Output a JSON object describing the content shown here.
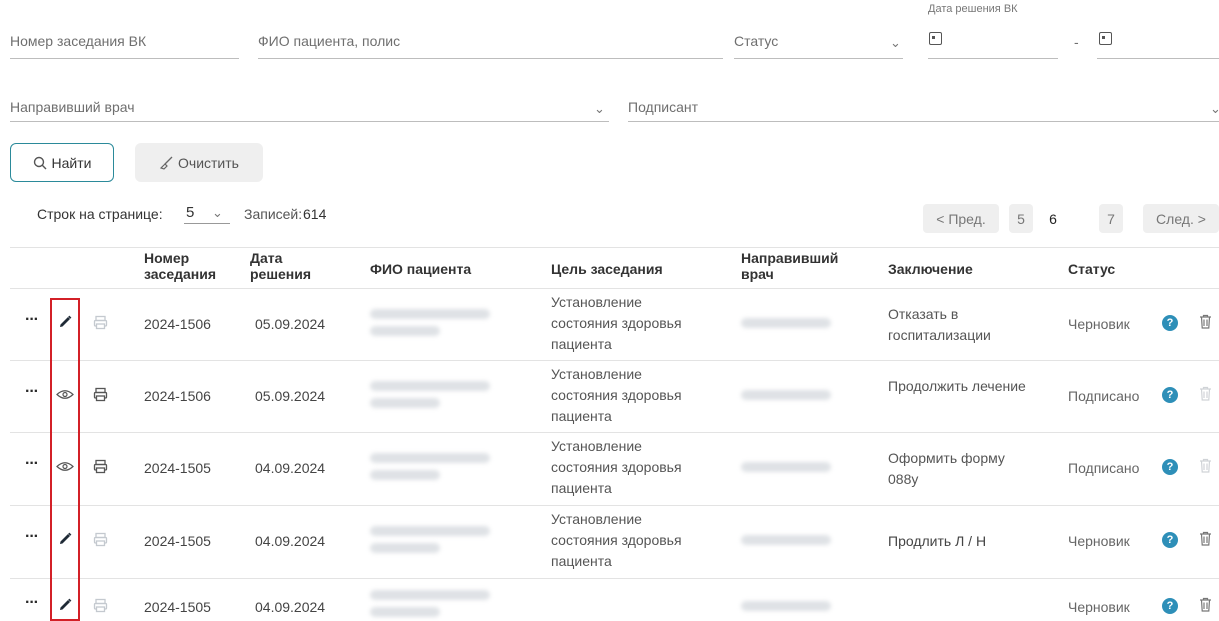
{
  "filters": {
    "meeting_number_placeholder": "Номер заседания ВК",
    "patient_placeholder": "ФИО пациента, полис",
    "status_placeholder": "Статус",
    "decision_date_label": "Дата решения ВК",
    "date_separator": "-",
    "referring_doctor_placeholder": "Направивший врач",
    "signer_placeholder": "Подписант"
  },
  "actions": {
    "find_label": "Найти",
    "clear_label": "Очистить"
  },
  "pagination": {
    "rows_per_page_label": "Строк на странице:",
    "rows_per_page_value": "5",
    "records_label": "Записей:",
    "records_value": "614",
    "prev_label": "< Пред.",
    "pages": [
      "5",
      "6",
      "7"
    ],
    "current_page": "6",
    "next_label": "След. >"
  },
  "table": {
    "headers": [
      "Номер заседания",
      "Дата решения",
      "ФИО пациента",
      "Цель заседания",
      "Направивший врач",
      "Заключение",
      "Статус"
    ],
    "rows": [
      {
        "number": "2024-1506",
        "date": "05.09.2024",
        "purpose": "Установление состояния здоровья пациента",
        "conclusion": "Отказать в госпитализации",
        "status": "Черновик",
        "action": "edit"
      },
      {
        "number": "2024-1506",
        "date": "05.09.2024",
        "purpose": "Установление состояния здоровья пациента",
        "conclusion": "Продолжить лечение",
        "status": "Подписано",
        "action": "view"
      },
      {
        "number": "2024-1505",
        "date": "04.09.2024",
        "purpose": "Установление состояния здоровья пациента",
        "conclusion": "Оформить форму 088у",
        "status": "Подписано",
        "action": "view"
      },
      {
        "number": "2024-1505",
        "date": "04.09.2024",
        "purpose": "Установление состояния здоровья пациента",
        "conclusion": "Продлить Л / Н",
        "status": "Черновик",
        "action": "edit"
      },
      {
        "number": "2024-1505",
        "date": "04.09.2024",
        "purpose": "",
        "conclusion": "",
        "status": "Черновик",
        "action": "edit"
      }
    ]
  },
  "colors": {
    "accent": "#2b8a9a",
    "help_icon": "#2e8fb8",
    "highlight": "#d32027"
  }
}
